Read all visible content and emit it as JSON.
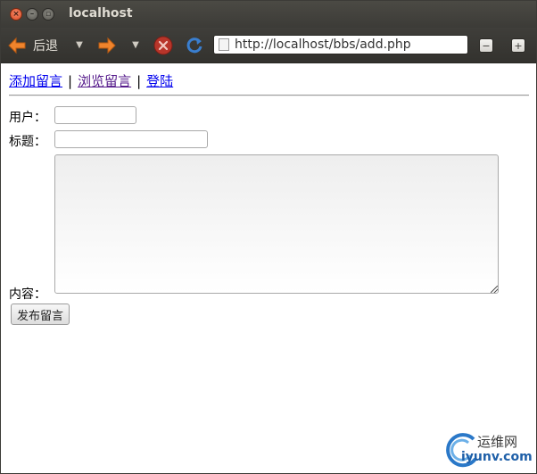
{
  "window": {
    "title": "localhost"
  },
  "toolbar": {
    "back_label": "后退",
    "url": "http://localhost/bbs/add.php"
  },
  "nav": {
    "links": [
      {
        "label": "添加留言",
        "visited": false
      },
      {
        "label": "浏览留言",
        "visited": true
      },
      {
        "label": "登陆",
        "visited": false
      }
    ],
    "separator": "|"
  },
  "form": {
    "user_label": "用户：",
    "user_value": "",
    "title_label": "标题：",
    "title_value": "",
    "content_label": "内容：",
    "content_value": "",
    "submit_label": "发布留言"
  },
  "watermark": {
    "line1": "运维网",
    "line2": "iyunv.com"
  },
  "colors": {
    "titlebar": "#3c3b37",
    "link": "#0000ee",
    "visited_link": "#551a8b",
    "accent_orange": "#f0842c",
    "reload_blue": "#3a7fd0",
    "stop_red": "#c23a2a"
  }
}
